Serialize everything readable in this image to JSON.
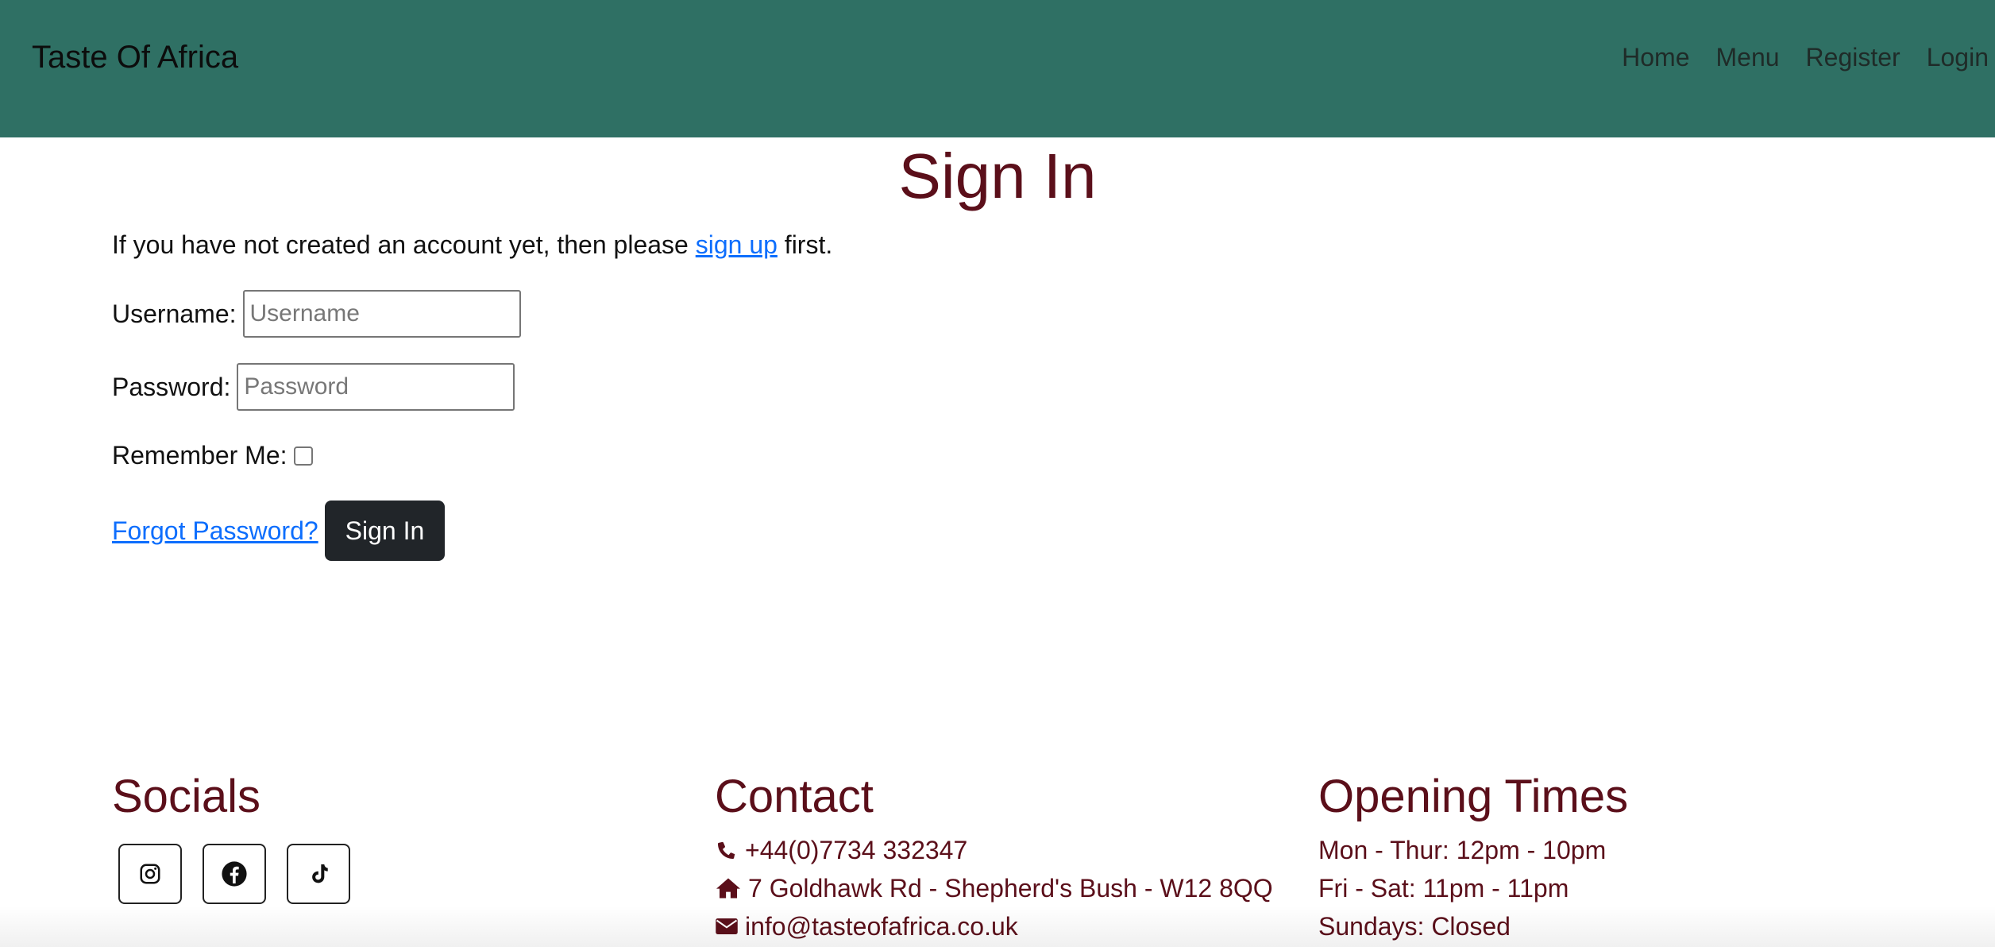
{
  "navbar": {
    "brand": "Taste Of Africa",
    "links": [
      "Home",
      "Menu",
      "Register",
      "Login"
    ]
  },
  "main": {
    "title": "Sign In",
    "intro": {
      "before": "If you have not created an account yet, then please ",
      "link": "sign up",
      "after": " first."
    },
    "form": {
      "username_label": "Username:",
      "username_placeholder": "Username",
      "password_label": "Password:",
      "password_placeholder": "Password",
      "remember_label": "Remember Me:",
      "remember_checked": false,
      "forgot_link": "Forgot Password?",
      "submit_label": "Sign In"
    }
  },
  "footer": {
    "socials": {
      "heading": "Socials",
      "icons": [
        "instagram-icon",
        "facebook-icon",
        "tiktok-icon"
      ]
    },
    "contact": {
      "heading": "Contact",
      "phone": "+44(0)7734 332347",
      "address": "7 Goldhawk Rd - Shepherd's Bush - W12 8QQ",
      "email": "info@tasteofafrica.co.uk"
    },
    "opening_times": {
      "heading": "Opening Times",
      "lines": [
        "Mon - Thur: 12pm - 10pm",
        "Fri - Sat: 11pm - 11pm",
        "Sundays: Closed"
      ]
    }
  },
  "colors": {
    "navbar_bg": "#2f7064",
    "heading": "#5b0f1a",
    "link": "#0d6efd",
    "button_bg": "#212529"
  }
}
